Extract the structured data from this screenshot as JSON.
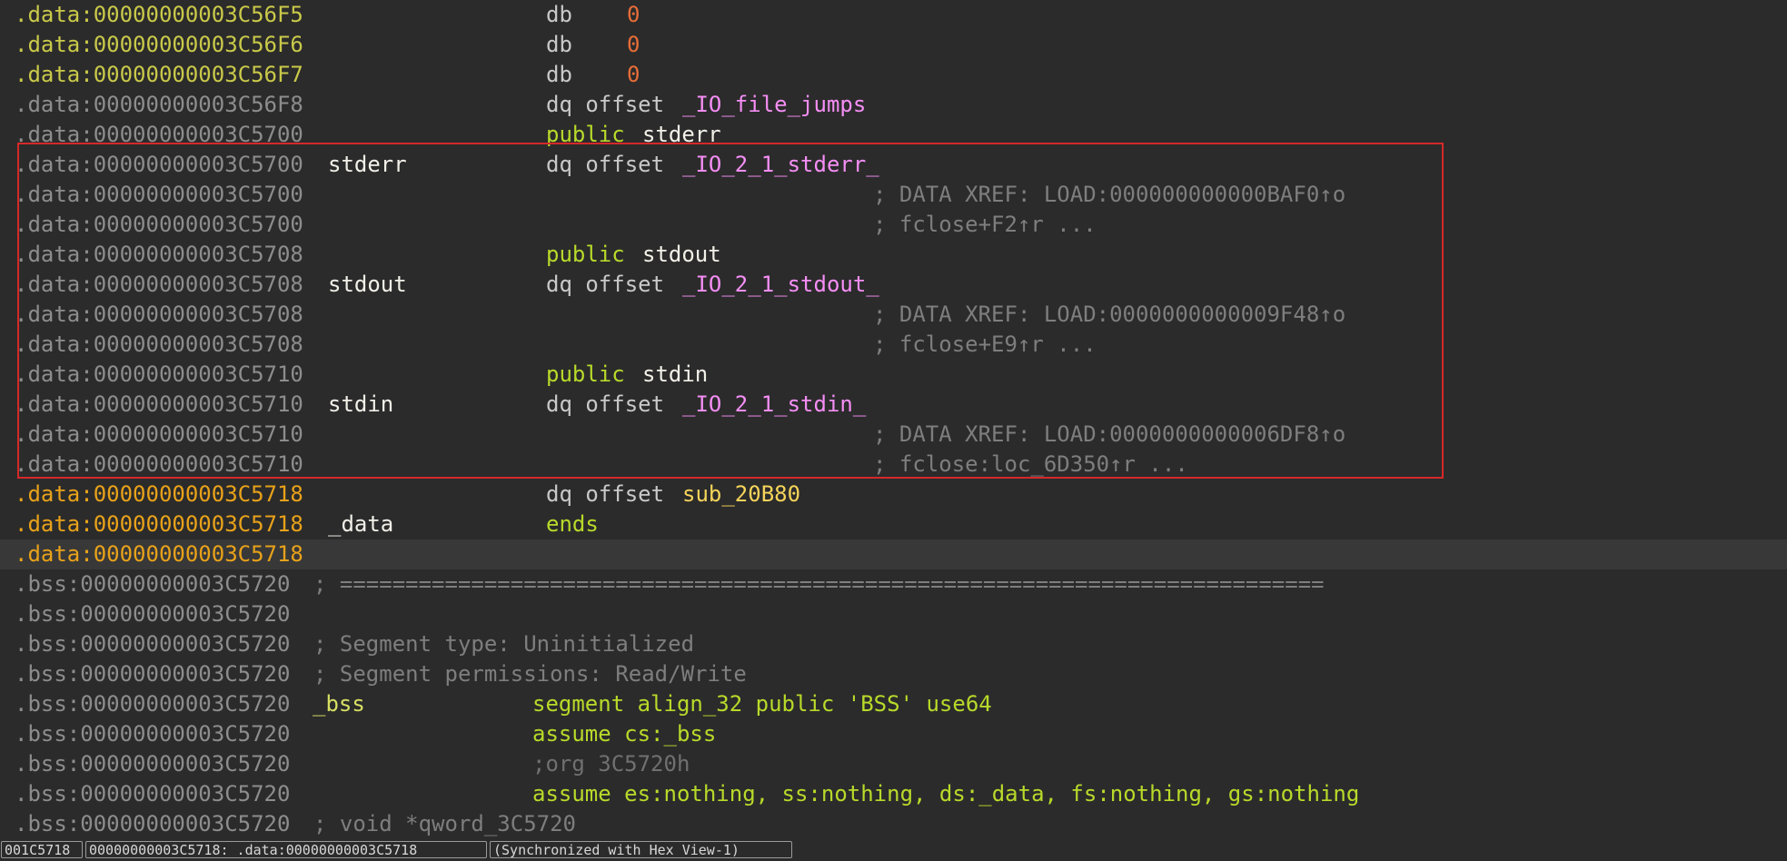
{
  "listing": {
    "lines": [
      {
        "addr": ".data:00000000003C56F5",
        "label": "",
        "op": "db",
        "arg1": "0",
        "comment": ""
      },
      {
        "addr": ".data:00000000003C56F6",
        "label": "",
        "op": "db",
        "arg1": "0",
        "comment": ""
      },
      {
        "addr": ".data:00000000003C56F7",
        "label": "",
        "op": "db",
        "arg1": "0",
        "comment": ""
      },
      {
        "addr": ".data:00000000003C56F8",
        "label": "",
        "op": "dq offset",
        "arg1": "_IO_file_jumps",
        "comment": ""
      },
      {
        "addr": ".data:00000000003C5700",
        "label": "",
        "op": "public",
        "arg1": "stderr",
        "comment": ""
      },
      {
        "addr": ".data:00000000003C5700",
        "label": "stderr",
        "op": "dq offset",
        "arg1": "_IO_2_1_stderr_",
        "comment": ""
      },
      {
        "addr": ".data:00000000003C5700",
        "label": "",
        "op": "",
        "arg1": "",
        "comment": "; DATA XREF: LOAD:000000000000BAF0↑o"
      },
      {
        "addr": ".data:00000000003C5700",
        "label": "",
        "op": "",
        "arg1": "",
        "comment": "; fclose+F2↑r ..."
      },
      {
        "addr": ".data:00000000003C5708",
        "label": "",
        "op": "public",
        "arg1": "stdout",
        "comment": ""
      },
      {
        "addr": ".data:00000000003C5708",
        "label": "stdout",
        "op": "dq offset",
        "arg1": "_IO_2_1_stdout_",
        "comment": ""
      },
      {
        "addr": ".data:00000000003C5708",
        "label": "",
        "op": "",
        "arg1": "",
        "comment": "; DATA XREF: LOAD:0000000000009F48↑o"
      },
      {
        "addr": ".data:00000000003C5708",
        "label": "",
        "op": "",
        "arg1": "",
        "comment": "; fclose+E9↑r ..."
      },
      {
        "addr": ".data:00000000003C5710",
        "label": "",
        "op": "public",
        "arg1": "stdin",
        "comment": ""
      },
      {
        "addr": ".data:00000000003C5710",
        "label": "stdin",
        "op": "dq offset",
        "arg1": "_IO_2_1_stdin_",
        "comment": ""
      },
      {
        "addr": ".data:00000000003C5710",
        "label": "",
        "op": "",
        "arg1": "",
        "comment": "; DATA XREF: LOAD:0000000000006DF8↑o"
      },
      {
        "addr": ".data:00000000003C5710",
        "label": "",
        "op": "",
        "arg1": "",
        "comment": "; fclose:loc_6D350↑r ..."
      },
      {
        "addr": ".data:00000000003C5718",
        "label": "",
        "op": "dq offset",
        "arg1": "sub_20B80",
        "comment": ""
      },
      {
        "addr": ".data:00000000003C5718",
        "label": "_data",
        "op": "ends",
        "arg1": "",
        "comment": ""
      },
      {
        "addr": ".data:00000000003C5718",
        "label": "",
        "op": "",
        "arg1": "",
        "comment": ""
      },
      {
        "addr": ".bss:00000000003C5720",
        "label": "",
        "op": "",
        "arg1": "",
        "comment": "; ==========================================================================="
      },
      {
        "addr": ".bss:00000000003C5720",
        "label": "",
        "op": "",
        "arg1": "",
        "comment": ""
      },
      {
        "addr": ".bss:00000000003C5720",
        "label": "",
        "op": "",
        "arg1": "",
        "comment": "; Segment type: Uninitialized"
      },
      {
        "addr": ".bss:00000000003C5720",
        "label": "",
        "op": "",
        "arg1": "",
        "comment": "; Segment permissions: Read/Write"
      },
      {
        "addr": ".bss:00000000003C5720",
        "label": "_bss",
        "op": "segment align_32 public 'BSS' use64",
        "arg1": "",
        "comment": ""
      },
      {
        "addr": ".bss:00000000003C5720",
        "label": "",
        "op": "assume cs:_bss",
        "arg1": "",
        "comment": ""
      },
      {
        "addr": ".bss:00000000003C5720",
        "label": "",
        "op": "",
        "arg1": "",
        "comment": ";org 3C5720h"
      },
      {
        "addr": ".bss:00000000003C5720",
        "label": "",
        "op": "assume es:nothing, ss:nothing, ds:_data, fs:nothing, gs:nothing",
        "arg1": "",
        "comment": ""
      },
      {
        "addr": ".bss:00000000003C5720",
        "label": "",
        "op": "",
        "arg1": "",
        "comment": "; void *qword_3C5720"
      }
    ]
  },
  "status": {
    "offset": "001C5718",
    "location": "00000000003C5718: .data:00000000003C5718",
    "sync": "(Synchronized with Hex View-1)"
  }
}
